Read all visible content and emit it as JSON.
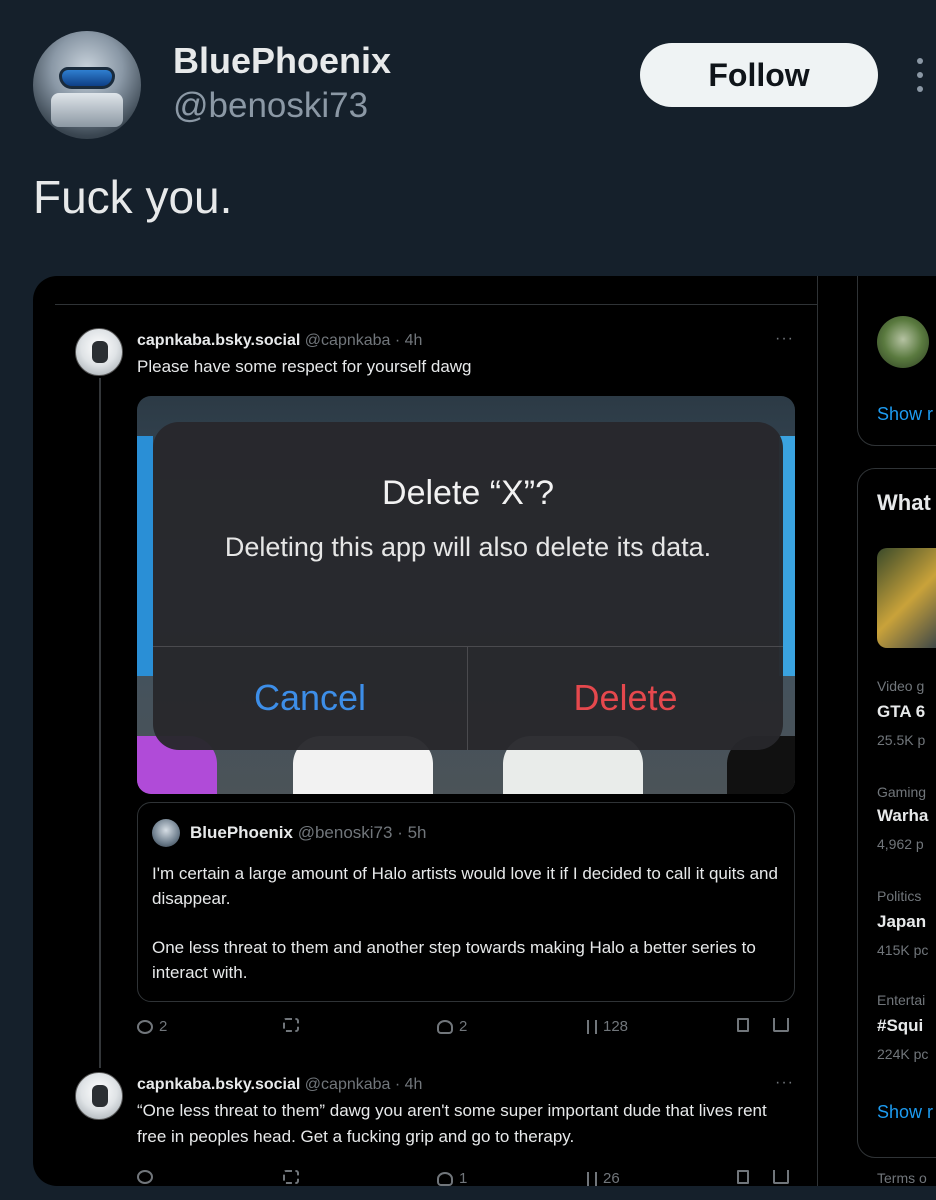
{
  "post": {
    "display_name": "BluePhoenix",
    "handle": "@benoski73",
    "follow_label": "Follow",
    "text": "Fuck you."
  },
  "embedded": {
    "reply1": {
      "name": "capnkaba.bsky.social",
      "meta": "@capnkaba · 4h",
      "text": "Please have some respect for yourself dawg",
      "more": "···"
    },
    "dialog": {
      "title": "Delete “X”?",
      "body": "Deleting this app will also delete its data.",
      "cancel": "Cancel",
      "delete": "Delete"
    },
    "quote": {
      "name": "BluePhoenix",
      "meta": "@benoski73 · 5h",
      "para1": "I'm certain a large amount of Halo artists would love it if I decided to call it quits and disappear.",
      "para2": "One less threat to them and another step towards making Halo a better series to interact with."
    },
    "actions1": {
      "replies": "2",
      "likes": "2",
      "views": "128"
    },
    "reply2": {
      "name": "capnkaba.bsky.social",
      "meta": "@capnkaba · 4h",
      "text": "“One less threat to them” dawg you aren't some super important dude that lives rent free in peoples head. Get a fucking grip and go to therapy.",
      "more": "···"
    },
    "actions2": {
      "likes": "1",
      "views": "26"
    },
    "sidebar": {
      "show_more_1": "Show r",
      "whats_head": "What",
      "trends": [
        {
          "category": "Video g",
          "name": "GTA 6",
          "count": "25.5K p"
        },
        {
          "category": "Gaming",
          "name": "Warha",
          "count": "4,962 p"
        },
        {
          "category": "Politics",
          "name": "Japan",
          "count": "415K pc"
        },
        {
          "category": "Entertai",
          "name": "#Squi",
          "count": "224K pc"
        }
      ],
      "show_more_2": "Show r",
      "terms": "Terms o"
    }
  },
  "colors": {
    "background": "#15202b",
    "accent_blue": "#1d9bf0",
    "cancel_blue": "#3d8ee8",
    "delete_red": "#e5484d"
  }
}
